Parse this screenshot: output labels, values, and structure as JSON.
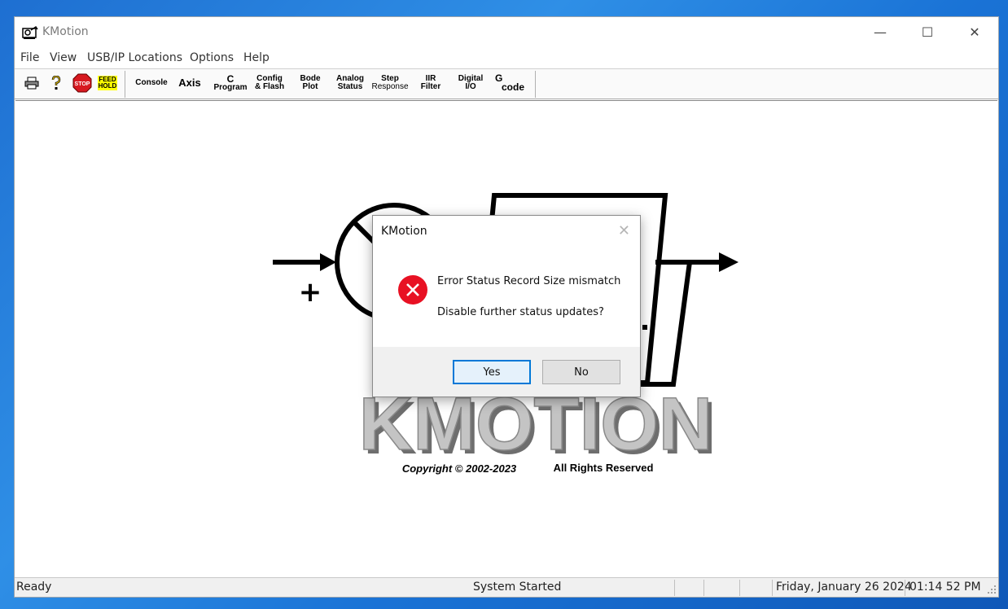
{
  "window": {
    "title": "KMotion",
    "controls": {
      "minimize": "—",
      "maximize": "☐",
      "close": "✕"
    }
  },
  "menu": [
    "File",
    "View",
    "USB/IP Locations",
    "Options",
    "Help"
  ],
  "toolbar": {
    "stop": "STOP",
    "feedhold": [
      "FEED",
      "HOLD"
    ],
    "console": "Console",
    "axis": "Axis",
    "c_program": [
      "C",
      "Program"
    ],
    "config_flash": [
      "Config",
      "& Flash"
    ],
    "bode_plot": [
      "Bode",
      "Plot"
    ],
    "analog_status": [
      "Analog",
      "Status"
    ],
    "step_response": [
      "Step",
      "Response"
    ],
    "iir_filter": [
      "IIR",
      "Filter"
    ],
    "digital_io": [
      "Digital",
      "I/O"
    ],
    "gcode": [
      "G",
      "code"
    ]
  },
  "splash": {
    "plus": "+",
    "logo": "KMOTION",
    "copyright": "Copyright © 2002-2023",
    "rights": "All Rights Reserved"
  },
  "dialog": {
    "title": "KMotion",
    "message": "Error Status Record Size mismatch",
    "question": "Disable further status updates?",
    "yes": "Yes",
    "no": "No",
    "close": "✕"
  },
  "statusbar": {
    "left": "Ready",
    "center": "System Started",
    "date": "Friday, January 26 2024",
    "time": "01:14 52 PM"
  },
  "colors": {
    "desktop": "#1e6fd1",
    "error_icon": "#e81123",
    "default_button_border": "#0078d7",
    "stop_red": "#d71920",
    "feedhold_yellow": "#ffff00"
  }
}
